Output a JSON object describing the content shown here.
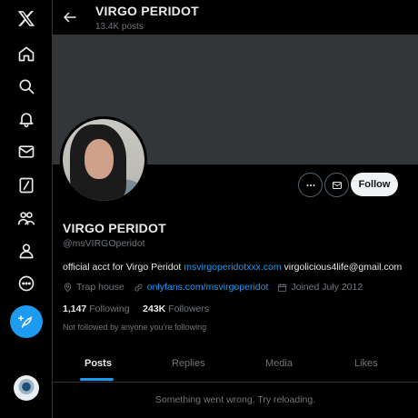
{
  "header": {
    "title": "VIRGO PERIDOT",
    "post_count": "13.4K posts"
  },
  "nav": {
    "items": [
      {
        "icon": "x-logo-icon"
      },
      {
        "icon": "home-icon"
      },
      {
        "icon": "search-icon"
      },
      {
        "icon": "bell-icon"
      },
      {
        "icon": "mail-icon"
      },
      {
        "icon": "grok-icon"
      },
      {
        "icon": "communities-icon"
      },
      {
        "icon": "profile-icon"
      },
      {
        "icon": "more-icon"
      }
    ],
    "compose_icon": "feather-plus-icon"
  },
  "profile": {
    "name": "VIRGO PERIDOT",
    "handle": "@msVIRGOperidot",
    "bio_prefix": "official acct for Virgo Peridot ",
    "bio_link": "msvirgoperidotxxx.com",
    "bio_suffix": " virgolicious4life@gmail.com",
    "location": "Trap house",
    "website": "onlyfans.com/msvirgoperidot",
    "joined": "Joined July 2012",
    "following_count": "1,147",
    "following_label": "Following",
    "followers_count": "243K",
    "followers_label": "Followers",
    "not_followed": "Not followed by anyone you’re following"
  },
  "actions": {
    "follow_label": "Follow"
  },
  "tabs": [
    {
      "label": "Posts",
      "active": true
    },
    {
      "label": "Replies",
      "active": false
    },
    {
      "label": "Media",
      "active": false
    },
    {
      "label": "Likes",
      "active": false
    }
  ],
  "error_message": "Something went wrong. Try reloading.",
  "colors": {
    "accent": "#1d9bf0",
    "background": "#000000",
    "muted": "#71767b"
  }
}
